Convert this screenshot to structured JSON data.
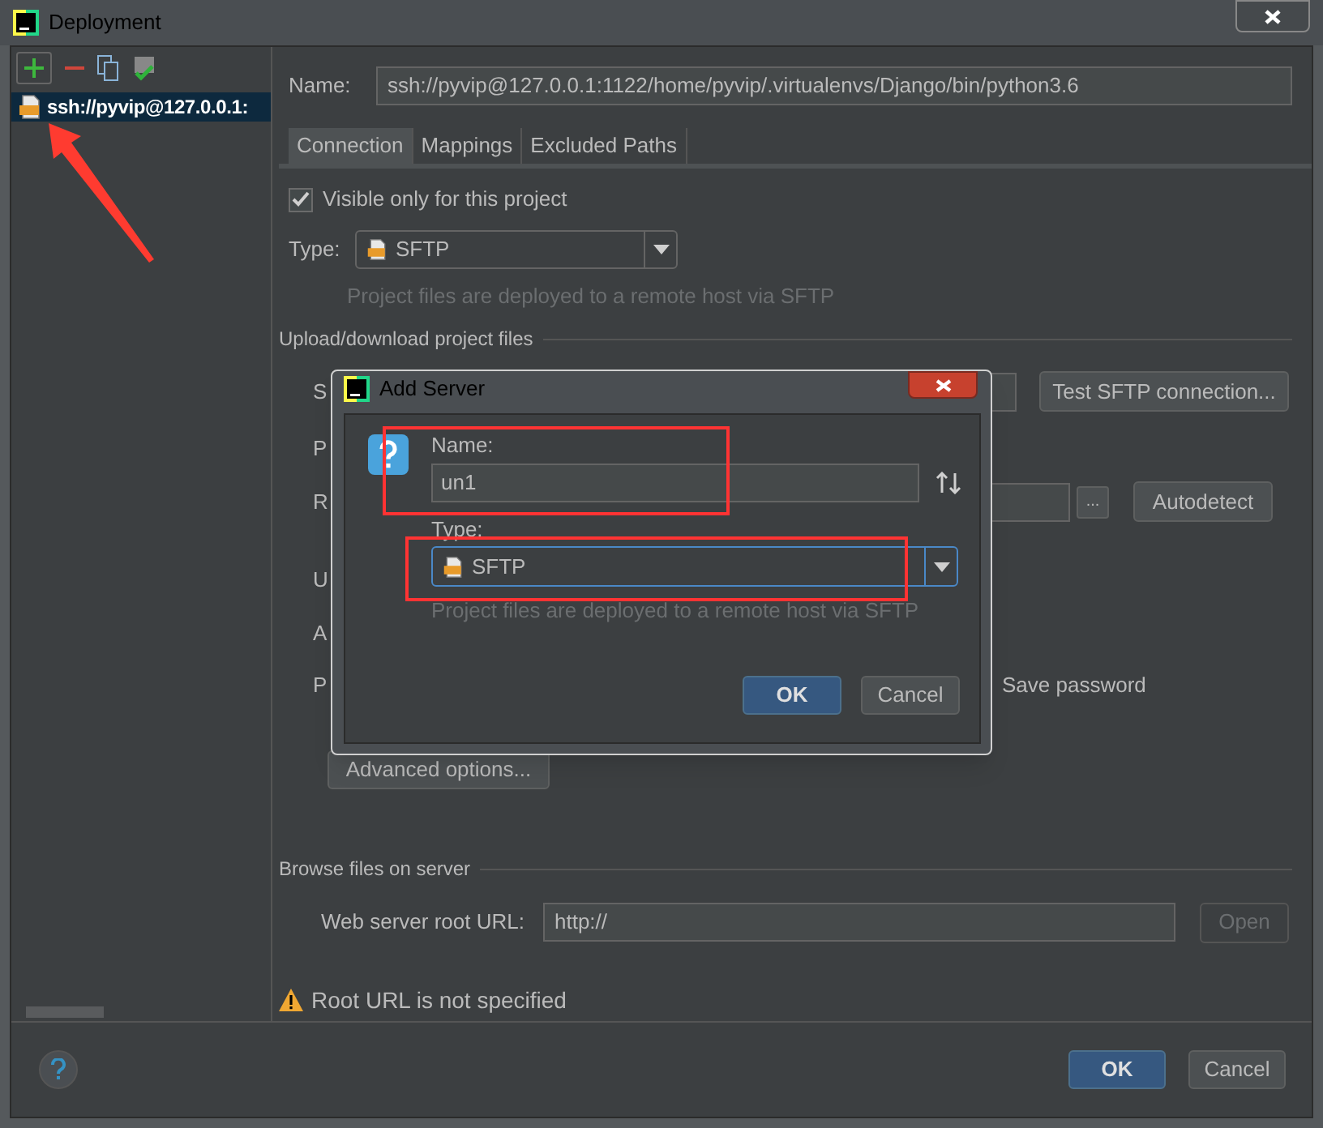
{
  "window": {
    "title": "Deployment"
  },
  "server_list": [
    {
      "label": "ssh://pyvip@127.0.0.1:",
      "selected": true
    }
  ],
  "name": {
    "label": "Name:",
    "value": "ssh://pyvip@127.0.0.1:1122/home/pyvip/.virtualenvs/Django/bin/python3.6"
  },
  "tabs": [
    {
      "label": "Connection",
      "selected": true
    },
    {
      "label": "Mappings",
      "selected": false
    },
    {
      "label": "Excluded Paths",
      "selected": false
    }
  ],
  "visible_only": {
    "label": "Visible only for this project",
    "checked": true
  },
  "type": {
    "label": "Type:",
    "value": "SFTP",
    "hint": "Project files are deployed to a remote host via SFTP"
  },
  "upload_section": {
    "title": "Upload/download project files",
    "row_labels": [
      "S",
      "P",
      "R",
      "U",
      "A",
      "P"
    ],
    "test_button": "Test SFTP connection...",
    "browse_button": "...",
    "autodetect_button": "Autodetect",
    "save_password": "Save password",
    "advanced_button": "Advanced options..."
  },
  "browse_section": {
    "title": "Browse files on server",
    "url_label": "Web server root URL:",
    "url_value": "http://",
    "open_button": {
      "label": "Open",
      "disabled": true
    }
  },
  "warning": "Root URL is not specified",
  "buttons": [
    {
      "label": "OK",
      "kind": "primary"
    },
    {
      "label": "Cancel",
      "kind": "secondary"
    }
  ],
  "add_server_dialog": {
    "title": "Add Server",
    "name_label": "Name:",
    "name_value": "un1",
    "type_label": "Type:",
    "type_value": "SFTP",
    "hint": "Project files are deployed to a remote host via SFTP",
    "buttons": [
      {
        "label": "OK",
        "kind": "primary"
      },
      {
        "label": "Cancel",
        "kind": "secondary"
      }
    ]
  }
}
